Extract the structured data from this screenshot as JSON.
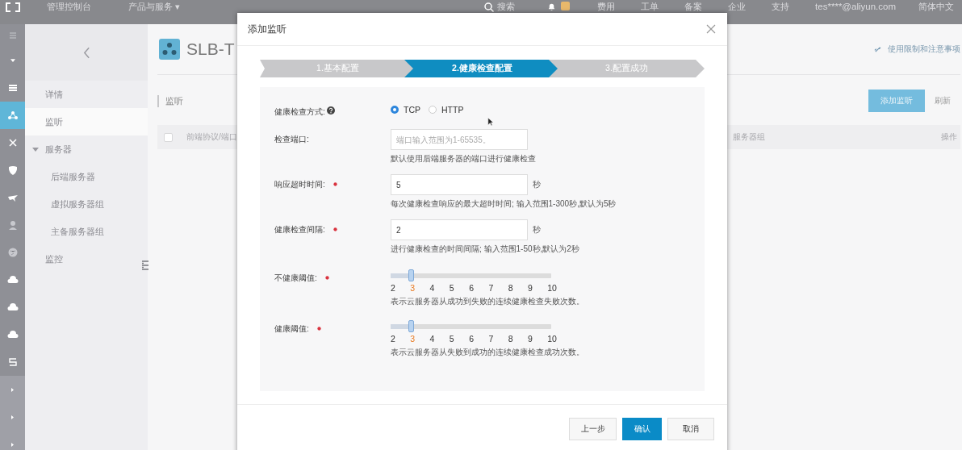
{
  "top_bar": {
    "console": "管理控制台",
    "products": "产品与服务",
    "products_caret": "▾",
    "search": "搜索",
    "nav": [
      "费用",
      "工单",
      "备案",
      "企业",
      "支持"
    ],
    "account": "tes****@aliyun.com",
    "language": "简体中文"
  },
  "rail": [
    {
      "kind": "menu",
      "selected": false
    },
    {
      "kind": "caret",
      "selected": false
    },
    {
      "kind": "stack",
      "selected": false
    },
    {
      "kind": "network",
      "selected": true
    },
    {
      "kind": "cross",
      "selected": false
    },
    {
      "kind": "shield",
      "selected": false
    },
    {
      "kind": "plane",
      "selected": false
    },
    {
      "kind": "person",
      "selected": false
    },
    {
      "kind": "globe",
      "selected": false
    },
    {
      "kind": "cloud",
      "selected": false
    },
    {
      "kind": "cloud",
      "selected": false
    },
    {
      "kind": "cloud",
      "selected": false
    },
    {
      "kind": "s",
      "selected": false
    },
    {
      "kind": "arrow",
      "selected": false
    },
    {
      "kind": "arrow",
      "selected": false
    },
    {
      "kind": "arrow",
      "selected": false
    }
  ],
  "sidebar": {
    "items": [
      {
        "label": "详情",
        "selected": false
      },
      {
        "label": "监听",
        "selected": true
      },
      {
        "label": "服务器",
        "selected": false,
        "expanded": true,
        "children": [
          {
            "label": "后端服务器",
            "selected": false
          },
          {
            "label": "虚拟服务器组",
            "selected": false
          },
          {
            "label": "主备服务器组",
            "selected": false
          }
        ]
      },
      {
        "label": "监控",
        "selected": false
      }
    ]
  },
  "page": {
    "title": "SLB-T",
    "section": "监听",
    "notice_link": "使用限制和注意事项",
    "buttons": [
      {
        "label": "添加监听",
        "kind": "primary"
      },
      {
        "label": "刷新",
        "kind": "plain"
      }
    ],
    "table": {
      "select_all": {
        "checked": false
      },
      "columns": [
        "前端协议/端口",
        "服务器组",
        "操作"
      ]
    }
  },
  "dialog": {
    "title": "添加监听",
    "steps": [
      {
        "label": "1.基本配置",
        "selected": false
      },
      {
        "label": "2.健康检查配置",
        "selected": true
      },
      {
        "label": "3.配置成功",
        "selected": false
      }
    ],
    "fields": [
      {
        "kind": "radio",
        "label": "健康检查方式:",
        "help": true,
        "options": [
          {
            "label": "TCP",
            "selected": true
          },
          {
            "label": "HTTP",
            "selected": false
          }
        ]
      },
      {
        "kind": "input",
        "label": "检查端口:",
        "placeholder": "端口输入范围为1-65535。",
        "hint": "默认使用后端服务器的端口进行健康检查"
      },
      {
        "kind": "input",
        "label": "响应超时时间:",
        "required": true,
        "value": "5",
        "unit": "秒",
        "hint": "每次健康检查响应的最大超时时间; 输入范围1-300秒,默认为5秒"
      },
      {
        "kind": "input",
        "label": "健康检查间隔:",
        "required": true,
        "value": "2",
        "unit": "秒",
        "hint": "进行健康检查的时间间隔; 输入范围1-50秒,默认为2秒"
      },
      {
        "kind": "slider",
        "label": "不健康阈值:",
        "required": true,
        "level": 0.125,
        "ticks": [
          {
            "label": "2",
            "selected": false
          },
          {
            "label": "3",
            "selected": true
          },
          {
            "label": "4",
            "selected": false
          },
          {
            "label": "5",
            "selected": false
          },
          {
            "label": "6",
            "selected": false
          },
          {
            "label": "7",
            "selected": false
          },
          {
            "label": "8",
            "selected": false
          },
          {
            "label": "9",
            "selected": false
          },
          {
            "label": "10",
            "selected": false
          }
        ],
        "hint": "表示云服务器从成功到失败的连续健康检查失败次数。"
      },
      {
        "kind": "slider",
        "label": "健康阈值:",
        "required": true,
        "level": 0.125,
        "ticks": [
          {
            "label": "2",
            "selected": false
          },
          {
            "label": "3",
            "selected": true
          },
          {
            "label": "4",
            "selected": false
          },
          {
            "label": "5",
            "selected": false
          },
          {
            "label": "6",
            "selected": false
          },
          {
            "label": "7",
            "selected": false
          },
          {
            "label": "8",
            "selected": false
          },
          {
            "label": "9",
            "selected": false
          },
          {
            "label": "10",
            "selected": false
          }
        ],
        "hint": "表示云服务器从失败到成功的连续健康检查成功次数。"
      }
    ],
    "buttons": [
      {
        "label": "上一步",
        "kind": "plain"
      },
      {
        "label": "确认",
        "kind": "primary"
      },
      {
        "label": "取消",
        "kind": "plain"
      }
    ]
  }
}
